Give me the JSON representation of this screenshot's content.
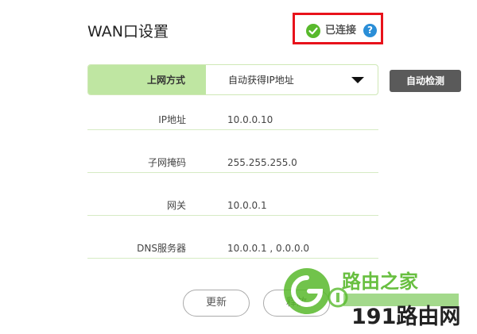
{
  "page": {
    "title": "WAN口设置"
  },
  "status": {
    "text": "已连接",
    "help_glyph": "?",
    "ok_color": "#58b92c",
    "frame_color": "#e8121b"
  },
  "mode": {
    "label": "上网方式",
    "value": "自动获得IP地址"
  },
  "detect_button": {
    "label": "自动检测"
  },
  "fields": [
    {
      "label": "IP地址",
      "value": "10.0.0.10"
    },
    {
      "label": "子网掩码",
      "value": "255.255.255.0"
    },
    {
      "label": "网关",
      "value": "10.0.0.1"
    },
    {
      "label": "DNS服务器",
      "value": "10.0.0.1 , 0.0.0.0"
    }
  ],
  "buttons": {
    "renew": "更新",
    "release": "释放"
  },
  "watermark": {
    "brand_cn": "路由之家",
    "site": "191路由网",
    "accent": "#58b92c"
  }
}
